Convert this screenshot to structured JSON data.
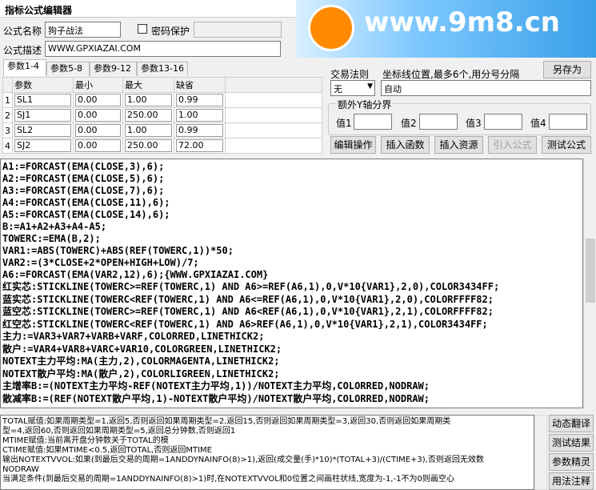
{
  "window": {
    "title": "指标公式编辑器"
  },
  "watermark": {
    "text": "www.9m8.cn"
  },
  "form": {
    "name_label": "公式名称",
    "name_value": "狗子战法",
    "password_label": "密码保护",
    "desc_label": "公式描述",
    "desc_value": "WWW.GPXIAZAI.COM",
    "trade_rule_label": "交易法则",
    "trade_rule_value": "无",
    "axis_label": "坐标线位置,最多6个,用分号分隔",
    "axis_value": "自动",
    "extra_y_label": "额外Y轴分界",
    "v1": "值1",
    "v2": "值2",
    "v3": "值3",
    "v4": "值4",
    "save_as": "另存为"
  },
  "tabs": [
    "参数1-4",
    "参数5-8",
    "参数9-12",
    "参数13-16"
  ],
  "params": {
    "headers": [
      "参数",
      "最小",
      "最大",
      "缺省"
    ],
    "rows": [
      {
        "i": "1",
        "name": "SL1",
        "min": "0.00",
        "max": "1.00",
        "def": "0.99"
      },
      {
        "i": "2",
        "name": "SJ1",
        "min": "0.00",
        "max": "250.00",
        "def": "1.00"
      },
      {
        "i": "3",
        "name": "SL2",
        "min": "0.00",
        "max": "1.00",
        "def": "0.99"
      },
      {
        "i": "4",
        "name": "SJ2",
        "min": "0.00",
        "max": "250.00",
        "def": "72.00"
      }
    ]
  },
  "buttons": {
    "edit": "编辑操作",
    "insert_func": "插入函数",
    "insert_res": "插入资源",
    "import": "引入公式",
    "test": "测试公式"
  },
  "side_buttons": [
    "动态翻译",
    "测试结果",
    "参数精灵",
    "用法注释"
  ],
  "code_lines": [
    "A1:=FORCAST(EMA(CLOSE,3),6);",
    "A2:=FORCAST(EMA(CLOSE,5),6);",
    "A3:=FORCAST(EMA(CLOSE,7),6);",
    "A4:=FORCAST(EMA(CLOSE,11),6);",
    "A5:=FORCAST(EMA(CLOSE,14),6);",
    "B:=A1+A2+A3+A4-A5;",
    "TOWERC:=EMA(B,2);",
    "VAR1:=ABS(TOWERC)+ABS(REF(TOWERC,1))*50;",
    "VAR2:=(3*CLOSE+2*OPEN+HIGH+LOW)/7;",
    "A6:=FORCAST(EMA(VAR2,12),6);{WWW.GPXIAZAI.COM}",
    "红实芯:STICKLINE(TOWERC>=REF(TOWERC,1) AND A6>=REF(A6,1),0,V*10{VAR1},2,0),COLOR3434FF;",
    "蓝实芯:STICKLINE(TOWERC<REF(TOWERC,1) AND A6<=REF(A6,1),0,V*10{VAR1},2,0),COLORFFFF82;",
    "蓝空芯:STICKLINE(TOWERC>=REF(TOWERC,1) AND A6<REF(A6,1),0,V*10{VAR1},2,1),COLORFFFF82;",
    "红空芯:STICKLINE(TOWERC<REF(TOWERC,1) AND A6>REF(A6,1),0,V*10{VAR1},2,1),COLOR3434FF;",
    "主力:=VAR3+VAR7+VARB+VARF,COLORRED,LINETHICK2;",
    "散户:=VAR4+VAR8+VARC+VAR10,COLORGREEN,LINETHICK2;",
    "NOTEXT主力平均:MA(主力,2),COLORMAGENTA,LINETHICK2;",
    "NOTEXT散户平均:MA(散户,2),COLORLIGREEN,LINETHICK2;",
    "主增率B:=(NOTEXT主力平均-REF(NOTEXT主力平均,1))/NOTEXT主力平均,COLORRED,NODRAW;",
    "散减率B:=(REF(NOTEXT散户平均,1)-NOTEXT散户平均)/NOTEXT散户平均,COLORRED,NODRAW;"
  ],
  "help_lines": [
    "TOTAL赋值:如果周期类型=1,返回5,否则返回如果周期类型=2,返回15,否则返回如果周期类型=3,返回30,否则返回如果周期类",
    "型=4,返回60,否则返回如果周期类型=5,返回总分钟数,否则返回1",
    "MTIME赋值:当前离开盘分钟数关于TOTAL的模",
    "CTIME赋值:如果MTIME<0.5,返回TOTAL,否则返回MTIME",
    "输出NOTEXTVVOL:如果(到最后交易的周期=1ANDDYNAINFO(8)>1),返回(成交量(手)*10)*(TOTAL+3)/(CTIME+3),否则返回无效数",
    "NODRAW",
    "当满足条件(到最后交易的周期=1ANDDYNAINFO(8)>1)时,在NOTEXTVVOL和0位置之间画柱状线,宽度为-1,-1不为0则画空心"
  ]
}
